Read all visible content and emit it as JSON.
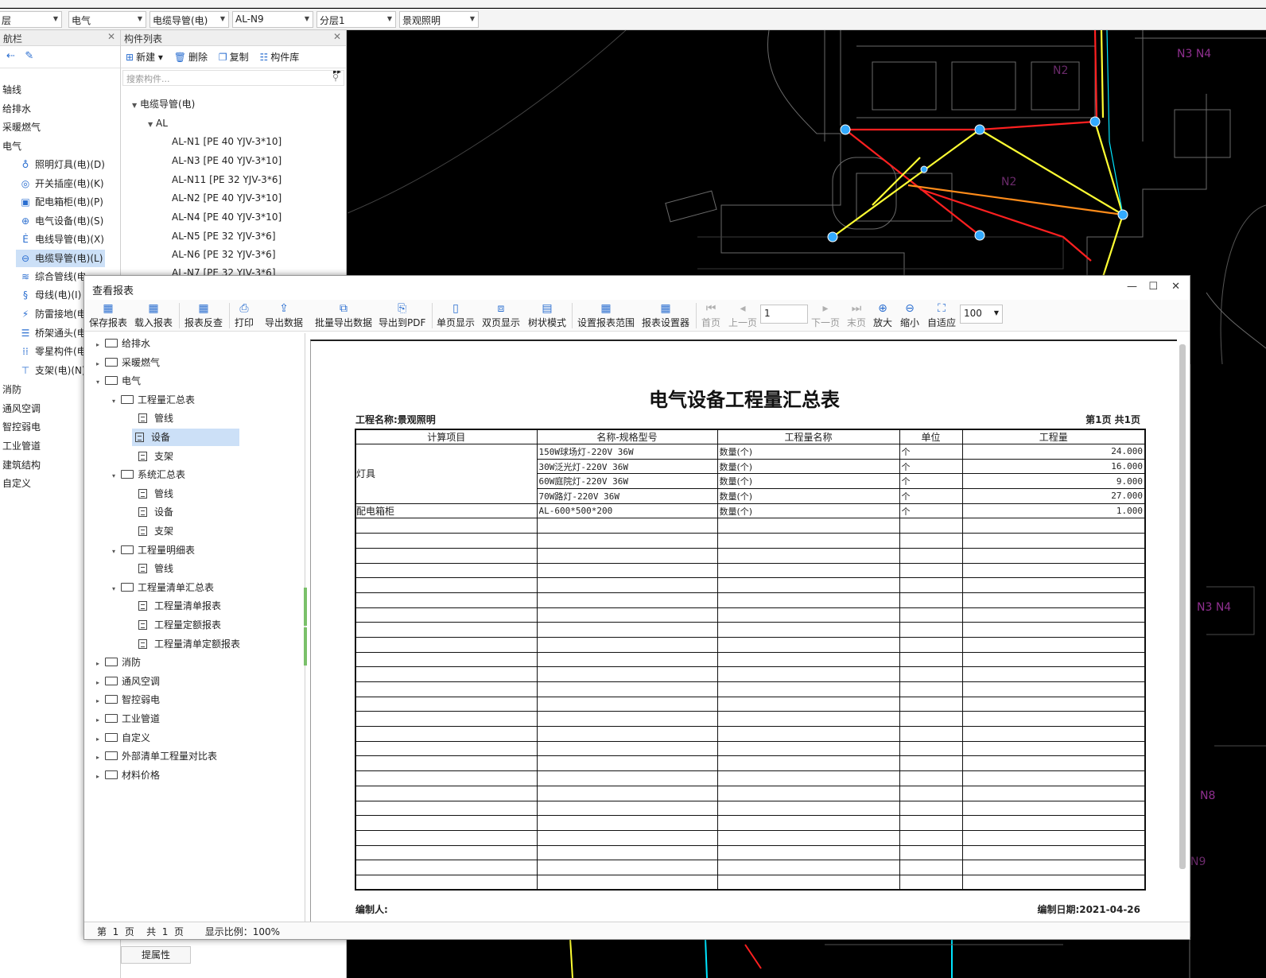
{
  "toolbar_combos": [
    {
      "value": "层"
    },
    {
      "value": "电气"
    },
    {
      "value": "电缆导管(电)"
    },
    {
      "value": "AL-N9"
    },
    {
      "value": "分层1"
    },
    {
      "value": "景观照明"
    }
  ],
  "nav": {
    "title": "航栏",
    "groups": [
      "轴线",
      "给排水",
      "采暖燃气",
      "电气"
    ],
    "items": [
      {
        "label": "照明灯具(电)(D)",
        "icon": "lamp-icon"
      },
      {
        "label": "开关插座(电)(K)",
        "icon": "switch-icon"
      },
      {
        "label": "配电箱柜(电)(P)",
        "icon": "panel-icon"
      },
      {
        "label": "电气设备(电)(S)",
        "icon": "device-icon"
      },
      {
        "label": "电线导管(电)(X)",
        "icon": "wire-icon"
      },
      {
        "label": "电缆导管(电)(L)",
        "icon": "cable-icon"
      },
      {
        "label": "综合管线(电",
        "icon": "pipeline-icon"
      },
      {
        "label": "母线(电)(I)",
        "icon": "busbar-icon"
      },
      {
        "label": "防雷接地(电",
        "icon": "lightning-icon"
      },
      {
        "label": "桥架通头(电",
        "icon": "tray-icon"
      },
      {
        "label": "零星构件(电",
        "icon": "misc-icon"
      },
      {
        "label": "支架(电)(N)",
        "icon": "bracket-icon"
      }
    ],
    "after_groups": [
      "消防",
      "通风空调",
      "智控弱电",
      "工业管道",
      "建筑结构",
      "自定义"
    ]
  },
  "complist": {
    "title": "构件列表",
    "tools": {
      "new": "新建",
      "delete": "删除",
      "copy": "复制",
      "library": "构件库"
    },
    "search_placeholder": "搜索构件...",
    "root": "电缆导管(电)",
    "group": "AL",
    "items": [
      "AL-N1 [PE 40 YJV-3*10]",
      "AL-N3 [PE 40 YJV-3*10]",
      "AL-N11 [PE 32 YJV-3*6]",
      "AL-N2 [PE 40 YJV-3*10]",
      "AL-N4 [PE 40 YJV-3*10]",
      "AL-N5 [PE 32 YJV-3*6]",
      "AL-N6 [PE 32 YJV-3*6]",
      "AL-N7 [PE 32 YJV-3*6]"
    ],
    "prop_tab": "提属性"
  },
  "cad": {
    "labels": [
      "N3 N4",
      "N2",
      "N2",
      "N3 N4",
      "N8",
      "N9"
    ],
    "colors": {
      "red": "#ff2020",
      "yellow": "#ffff33",
      "orange": "#ff8c1a",
      "blue": "#33aaff",
      "cyan": "#00e5ff",
      "line": "#7f7f7f"
    }
  },
  "report": {
    "window_title": "查看报表",
    "toolbar": {
      "save": "保存报表",
      "load": "载入报表",
      "check": "报表反查",
      "print": "打印",
      "export": "导出数据",
      "batch_export": "批量导出数据",
      "pdf": "导出到PDF",
      "single": "单页显示",
      "double": "双页显示",
      "tree_mode": "树状模式",
      "range": "设置报表范围",
      "settings": "报表设置器",
      "first": "首页",
      "prev": "上一页",
      "page_value": "1",
      "next": "下一页",
      "last": "末页",
      "zoom_in": "放大",
      "zoom_out": "缩小",
      "fit": "自适应",
      "zoom_value": "100"
    },
    "tree": [
      {
        "label": "给排水",
        "level": 0,
        "kind": "folder",
        "toggle": "▸"
      },
      {
        "label": "采暖燃气",
        "level": 0,
        "kind": "folder",
        "toggle": "▸"
      },
      {
        "label": "电气",
        "level": 0,
        "kind": "folder",
        "toggle": "▾"
      },
      {
        "label": "工程量汇总表",
        "level": 1,
        "kind": "folder",
        "toggle": "▾"
      },
      {
        "label": "管线",
        "level": 2,
        "kind": "doc"
      },
      {
        "label": "设备",
        "level": 2,
        "kind": "doc",
        "selected": true
      },
      {
        "label": "支架",
        "level": 2,
        "kind": "doc"
      },
      {
        "label": "系统汇总表",
        "level": 1,
        "kind": "folder",
        "toggle": "▾"
      },
      {
        "label": "管线",
        "level": 2,
        "kind": "doc"
      },
      {
        "label": "设备",
        "level": 2,
        "kind": "doc"
      },
      {
        "label": "支架",
        "level": 2,
        "kind": "doc"
      },
      {
        "label": "工程量明细表",
        "level": 1,
        "kind": "folder",
        "toggle": "▾"
      },
      {
        "label": "管线",
        "level": 2,
        "kind": "doc"
      },
      {
        "label": "工程量清单汇总表",
        "level": 1,
        "kind": "folder",
        "toggle": "▾"
      },
      {
        "label": "工程量清单报表",
        "level": 2,
        "kind": "doc"
      },
      {
        "label": "工程量定额报表",
        "level": 2,
        "kind": "doc"
      },
      {
        "label": "工程量清单定额报表",
        "level": 2,
        "kind": "doc"
      },
      {
        "label": "消防",
        "level": 0,
        "kind": "folder",
        "toggle": "▸"
      },
      {
        "label": "通风空调",
        "level": 0,
        "kind": "folder",
        "toggle": "▸"
      },
      {
        "label": "智控弱电",
        "level": 0,
        "kind": "folder",
        "toggle": "▸"
      },
      {
        "label": "工业管道",
        "level": 0,
        "kind": "folder",
        "toggle": "▸"
      },
      {
        "label": "自定义",
        "level": 0,
        "kind": "folder",
        "toggle": "▸"
      },
      {
        "label": "外部清单工程量对比表",
        "level": 0,
        "kind": "folder",
        "toggle": "▸"
      },
      {
        "label": "材料价格",
        "level": 0,
        "kind": "folder",
        "toggle": "▸"
      }
    ],
    "status": "第  1  页    共  1  页       显示比例：100%",
    "page": {
      "title": "电气设备工程量汇总表",
      "project": "工程名称:景观照明",
      "pages": "第1页  共1页",
      "editor": "编制人:",
      "date": "编制日期:2021-04-26",
      "columns": [
        "计算项目",
        "名称-规格型号",
        "工程量名称",
        "单位",
        "工程量"
      ],
      "groups": [
        {
          "category": "灯具",
          "rows": [
            {
              "spec": "150W球场灯-220V 36W",
              "qty_name": "数量(个)",
              "unit": "个",
              "qty": "24.000"
            },
            {
              "spec": "30W泛光灯-220V 36W",
              "qty_name": "数量(个)",
              "unit": "个",
              "qty": "16.000"
            },
            {
              "spec": "60W庭院灯-220V 36W",
              "qty_name": "数量(个)",
              "unit": "个",
              "qty": "9.000"
            },
            {
              "spec": "70W路灯-220V 36W",
              "qty_name": "数量(个)",
              "unit": "个",
              "qty": "27.000"
            }
          ]
        },
        {
          "category": "配电箱柜",
          "rows": [
            {
              "spec": "AL-600*500*200",
              "qty_name": "数量(个)",
              "unit": "个",
              "qty": "1.000"
            }
          ]
        }
      ],
      "empty_rows": 25
    }
  }
}
